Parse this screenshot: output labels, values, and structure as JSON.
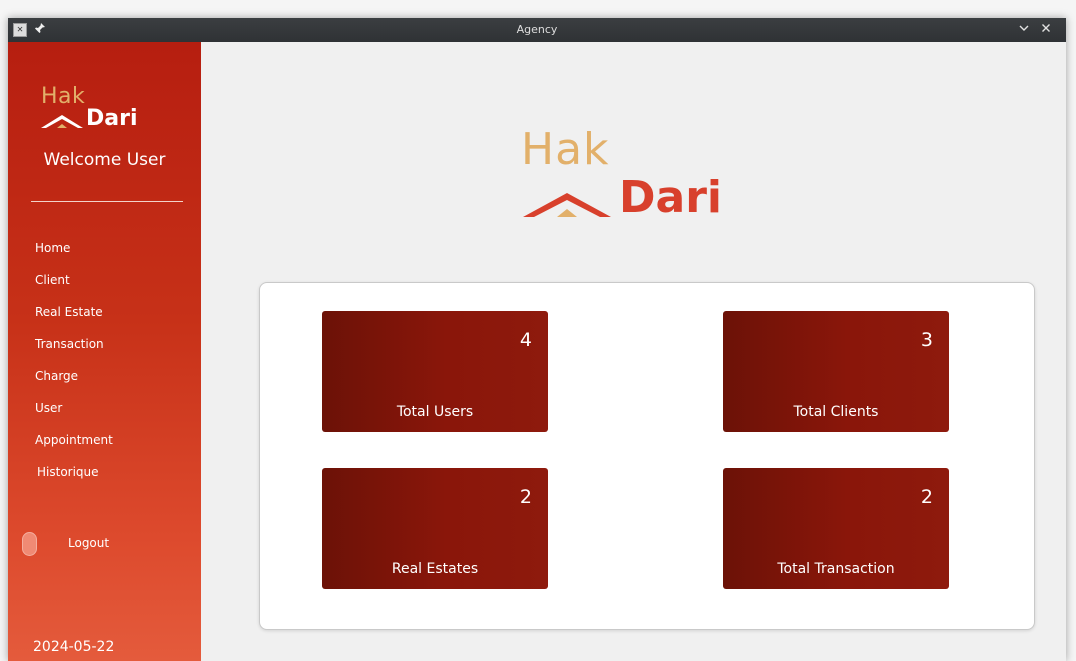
{
  "window": {
    "title": "Agency",
    "icons": {
      "app": "app-icon",
      "pin": "pin-icon",
      "minimize": "chevron-down-icon",
      "close": "close-icon"
    }
  },
  "brand": {
    "line1": "Hak",
    "line2": "Dari",
    "colors": {
      "gold": "#e2b06a",
      "red": "#d8402c",
      "white": "#ffffff"
    }
  },
  "sidebar": {
    "welcome": "Welcome User",
    "nav": [
      {
        "label": "Home"
      },
      {
        "label": "Client"
      },
      {
        "label": "Real Estate"
      },
      {
        "label": "Transaction"
      },
      {
        "label": "Charge"
      },
      {
        "label": "User"
      },
      {
        "label": "Appointment"
      },
      {
        "label": "Historique"
      }
    ],
    "logout_label": "Logout",
    "date": "2024-05-22"
  },
  "stats": [
    {
      "count": "4",
      "label": "Total Users"
    },
    {
      "count": "3",
      "label": "Total Clients"
    },
    {
      "count": "2",
      "label": "Real Estates"
    },
    {
      "count": "2",
      "label": "Total Transaction"
    }
  ],
  "theme": {
    "sidebar_top": "#b61e10",
    "sidebar_bottom": "#e45b3c",
    "card_bg": "#8a160a"
  }
}
